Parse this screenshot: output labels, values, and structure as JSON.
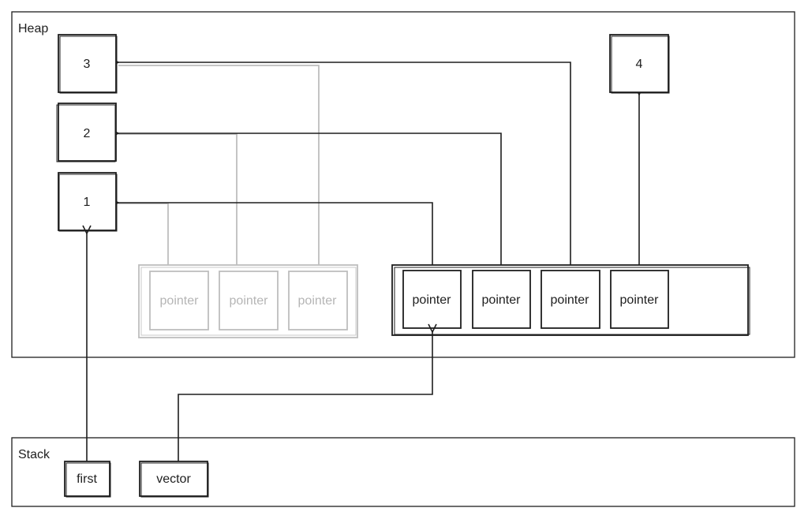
{
  "heap": {
    "label": "Heap",
    "values": [
      "3",
      "2",
      "1",
      "4"
    ],
    "old_vector": {
      "pointers": [
        "pointer",
        "pointer",
        "pointer"
      ],
      "color": "#bdbdbd"
    },
    "new_vector": {
      "pointers": [
        "pointer",
        "pointer",
        "pointer",
        "pointer"
      ],
      "color": "#1e1e1e"
    }
  },
  "stack": {
    "label": "Stack",
    "vars": [
      "first",
      "vector"
    ]
  }
}
